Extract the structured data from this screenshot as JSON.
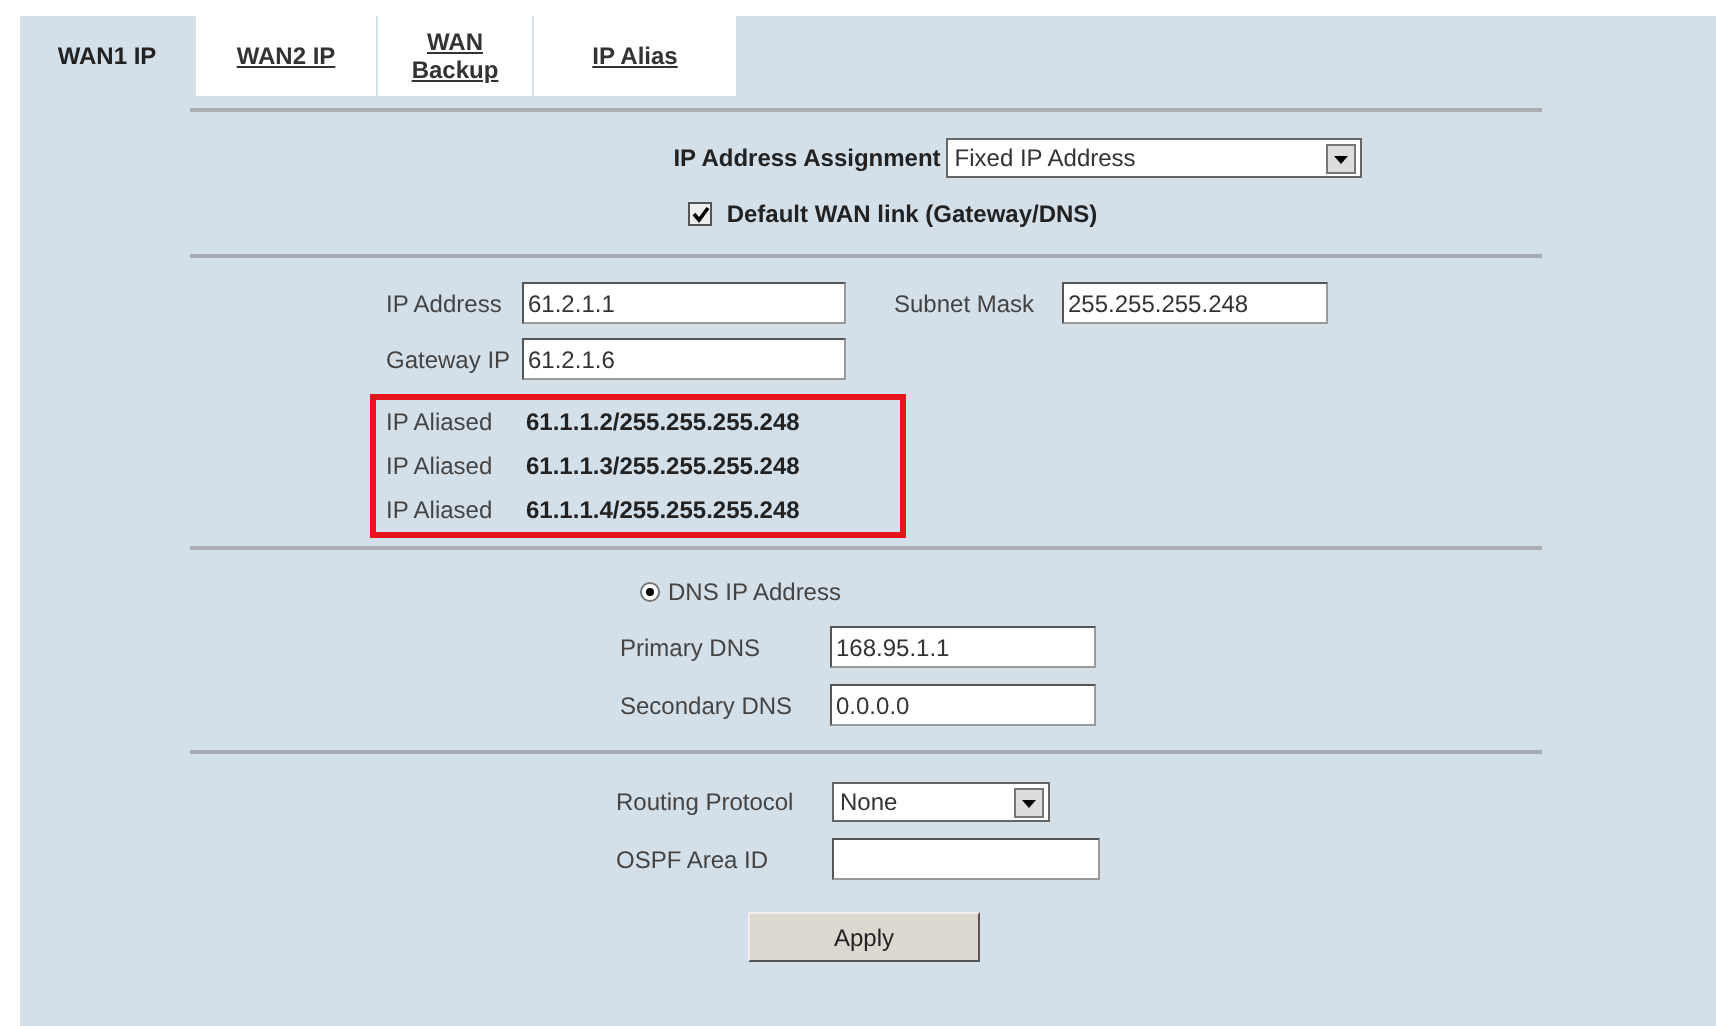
{
  "tabs": [
    {
      "label": "WAN1 IP",
      "selected": true
    },
    {
      "label": "WAN2 IP",
      "selected": false
    },
    {
      "label": "WAN Backup",
      "selected": false
    },
    {
      "label": "IP Alias",
      "selected": false
    }
  ],
  "ip_assignment": {
    "label": "IP Address Assignment",
    "value": "Fixed IP Address"
  },
  "default_wan": {
    "label": "Default WAN link (Gateway/DNS)",
    "checked": true
  },
  "ip_address": {
    "label": "IP Address",
    "value": "61.2.1.1"
  },
  "subnet_mask": {
    "label": "Subnet Mask",
    "value": "255.255.255.248"
  },
  "gateway": {
    "label": "Gateway IP",
    "value": "61.2.1.6"
  },
  "aliases": [
    {
      "label": "IP Aliased",
      "value": "61.1.1.2/255.255.255.248"
    },
    {
      "label": "IP Aliased",
      "value": "61.1.1.3/255.255.255.248"
    },
    {
      "label": "IP Aliased",
      "value": "61.1.1.4/255.255.255.248"
    }
  ],
  "dns_radio": {
    "label": "DNS IP Address",
    "selected": true
  },
  "primary_dns": {
    "label": "Primary DNS",
    "value": "168.95.1.1"
  },
  "secondary_dns": {
    "label": "Secondary DNS",
    "value": "0.0.0.0"
  },
  "routing_protocol": {
    "label": "Routing Protocol",
    "value": "None"
  },
  "ospf_area": {
    "label": "OSPF Area ID"
  },
  "apply": "Apply"
}
